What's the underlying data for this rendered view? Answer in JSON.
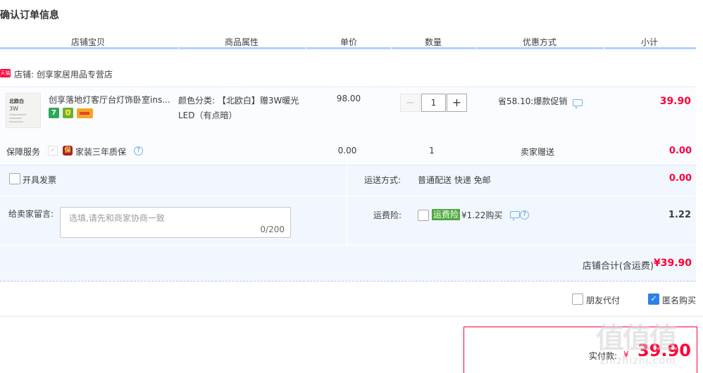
{
  "page_title": "确认订单信息",
  "columns": [
    "店铺宝贝",
    "商品属性",
    "单价",
    "数量",
    "优惠方式",
    "小计"
  ],
  "shop": {
    "badge": "天猫",
    "name": "店铺: 创享家居用品专营店"
  },
  "item": {
    "thumb_line1": "北欧白",
    "thumb_line2": "3W",
    "name": "创享落地灯客厅台灯饰卧室ins...",
    "attribute": "颜色分类: 【北欧白】赠3W暖光LED（有点暗）",
    "price": "98.00",
    "quantity": "1",
    "minus_label": "−",
    "plus_label": "+",
    "promotion": "省58.10:爆款促销",
    "subtotal": "39.90",
    "icon_badge_7": "7"
  },
  "service": {
    "label": "保障服务",
    "bao_char": "保",
    "name": "家装三年质保",
    "price": "0.00",
    "quantity": "1",
    "gift": "卖家赠送",
    "subtotal": "0.00",
    "check_char": "✓",
    "help_char": "?"
  },
  "invoice": {
    "label": "开具发票"
  },
  "shipping": {
    "label": "运送方式:",
    "value": "普通配送 快递 免邮",
    "cost": "0.00"
  },
  "note": {
    "label": "给卖家留言:",
    "placeholder": "选填,请先和商家协商一致",
    "counter": "0/200"
  },
  "insurance": {
    "label": "运费险:",
    "tag": "运费险",
    "text": "¥1.22购买",
    "value": "1.22",
    "help_char": "?"
  },
  "shop_total": {
    "label": "店铺合计(含运费)",
    "value": "¥39.90"
  },
  "options": {
    "friend_pay": "朋友代付",
    "anonymous": "匿名购买",
    "check_char": "✓"
  },
  "payment": {
    "label": "实付款:",
    "currency": "¥",
    "value": "39.90"
  },
  "watermark": {
    "big": "值值值",
    "site": "zhizhizhi.com"
  },
  "colors": {
    "accent_red": "#ff0036",
    "header_line": "#b2d1ff",
    "panel_bg": "#f2f7ff",
    "checked_blue": "#2f7fe8",
    "insurance_green": "#4fa83f"
  }
}
